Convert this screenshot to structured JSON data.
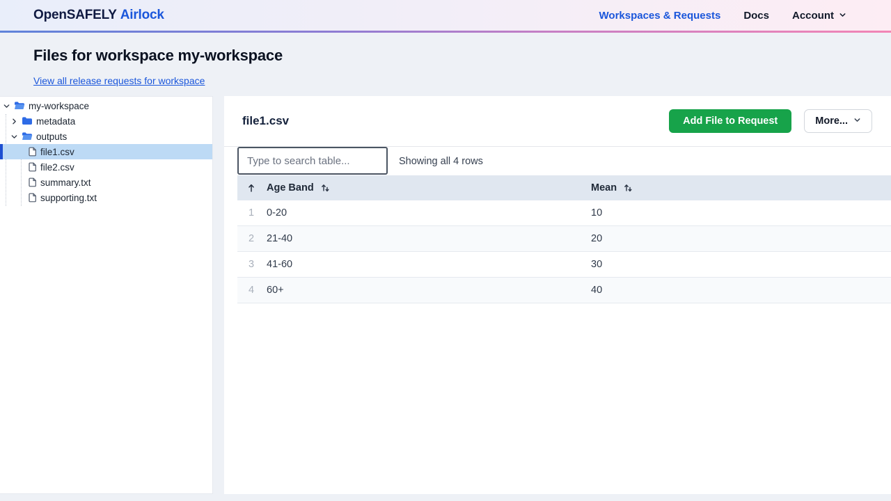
{
  "nav": {
    "logo_primary": "OpenSAFELY",
    "logo_secondary": "Airlock",
    "links": [
      {
        "label": "Workspaces & Requests"
      },
      {
        "label": "Docs"
      }
    ],
    "account_label": "Account"
  },
  "page_header": {
    "title": "Files for workspace my-workspace",
    "link_label": "View all release requests for workspace"
  },
  "sidebar": {
    "tree": [
      {
        "label": "my-workspace",
        "kind": "folder-open",
        "expanded": true
      },
      {
        "label": "metadata",
        "kind": "folder-closed",
        "expanded": false
      },
      {
        "label": "outputs",
        "kind": "folder-open",
        "expanded": true
      },
      {
        "label": "file1.csv",
        "kind": "file",
        "selected": true
      },
      {
        "label": "file2.csv",
        "kind": "file"
      },
      {
        "label": "summary.txt",
        "kind": "file"
      },
      {
        "label": "supporting.txt",
        "kind": "file"
      }
    ]
  },
  "main": {
    "file_title": "file1.csv",
    "add_file_button": "Add File to Request",
    "more_button": "More...",
    "search_placeholder": "Type to search table...",
    "rows_status": "Showing all 4 rows",
    "table": {
      "columns": [
        "Age Band",
        "Mean"
      ],
      "rows": [
        [
          "1",
          "0-20",
          "10"
        ],
        [
          "2",
          "21-40",
          "20"
        ],
        [
          "3",
          "41-60",
          "30"
        ],
        [
          "4",
          "60+",
          "40"
        ]
      ]
    }
  },
  "colors": {
    "accent_green": "#17a34a",
    "brand_blue": "#1a56db",
    "selected_file_bg": "#bddaf5",
    "selected_file_bar": "#1e4fd1",
    "table_header_bg": "#e0e7f0",
    "gradient_rule": [
      "#5f83da",
      "#8f7cd3",
      "#f285b5"
    ]
  }
}
